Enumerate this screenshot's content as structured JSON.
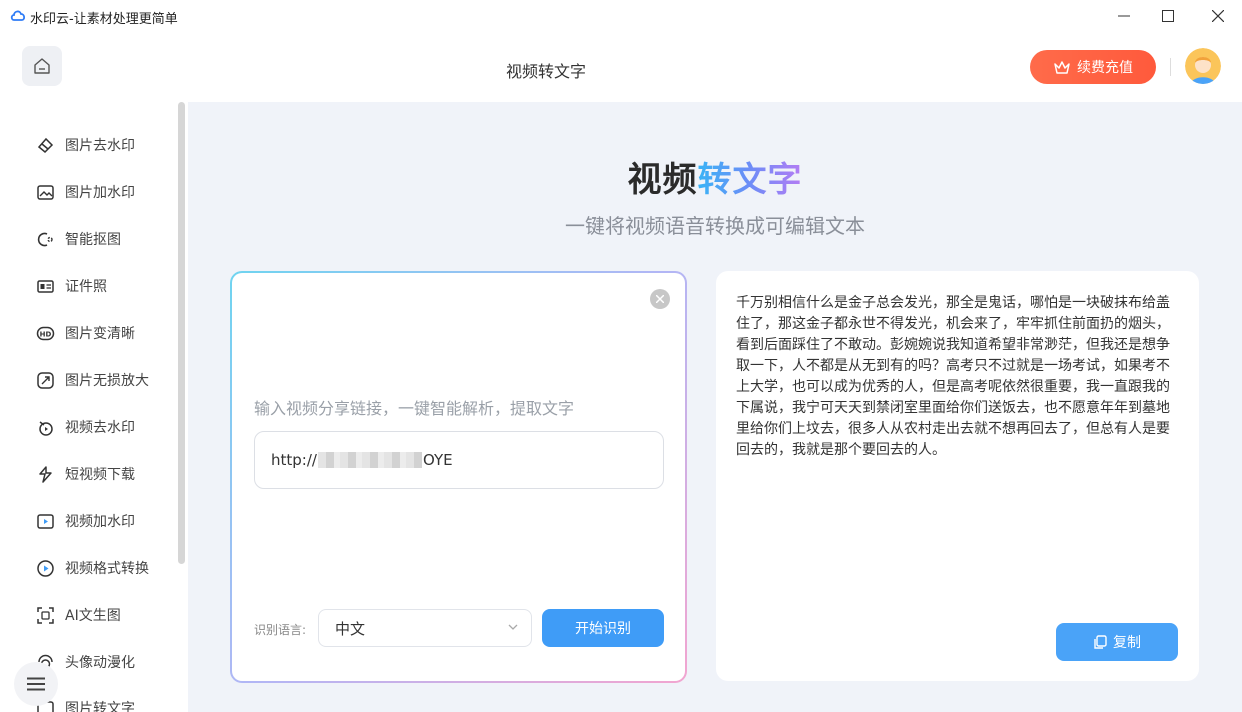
{
  "window": {
    "title": "水印云-让素材处理更简单"
  },
  "header": {
    "page_title": "视频转文字",
    "recharge_label": "续费充值"
  },
  "sidebar": {
    "items": [
      {
        "label": "图片去水印",
        "icon": "eraser-icon"
      },
      {
        "label": "图片加水印",
        "icon": "image-add-icon"
      },
      {
        "label": "智能抠图",
        "icon": "cutout-icon"
      },
      {
        "label": "证件照",
        "icon": "id-card-icon"
      },
      {
        "label": "图片变清晰",
        "icon": "hd-icon"
      },
      {
        "label": "图片无损放大",
        "icon": "enlarge-icon"
      },
      {
        "label": "视频去水印",
        "icon": "video-eraser-icon"
      },
      {
        "label": "短视频下载",
        "icon": "short-video-download-icon"
      },
      {
        "label": "视频加水印",
        "icon": "video-add-icon"
      },
      {
        "label": "视频格式转换",
        "icon": "play-circle-icon"
      },
      {
        "label": "AI文生图",
        "icon": "ai-image-icon"
      },
      {
        "label": "头像动漫化",
        "icon": "avatar-anime-icon"
      },
      {
        "label": "图片转文字",
        "icon": "image-text-icon"
      }
    ]
  },
  "hero": {
    "title_part1": "视频",
    "title_part2": "转文字",
    "subtitle": "一键将视频语音转换成可编辑文本"
  },
  "input_panel": {
    "hint": "输入视频分享链接，一键智能解析，提取文字",
    "url_prefix": "http://",
    "url_suffix": "OYE",
    "lang_label": "识别语言:",
    "lang_value": "中文",
    "start_label": "开始识别"
  },
  "output_panel": {
    "text": "千万别相信什么是金子总会发光，那全是鬼话，哪怕是一块破抹布给盖住了，那这金子都永世不得发光，机会来了，牢牢抓住前面扔的烟头，看到后面踩住了不敢动。彭婉婉说我知道希望非常渺茫，但我还是想争取一下，人不都是从无到有的吗？高考只不过就是一场考试，如果考不上大学，也可以成为优秀的人，但是高考呢依然很重要，我一直跟我的下属说，我宁可天天到禁闭室里面给你们送饭去，也不愿意年年到墓地里给你们上坟去，很多人从农村走出去就不想再回去了，但总有人是要回去的，我就是那个要回去的人。",
    "copy_label": "复制"
  }
}
